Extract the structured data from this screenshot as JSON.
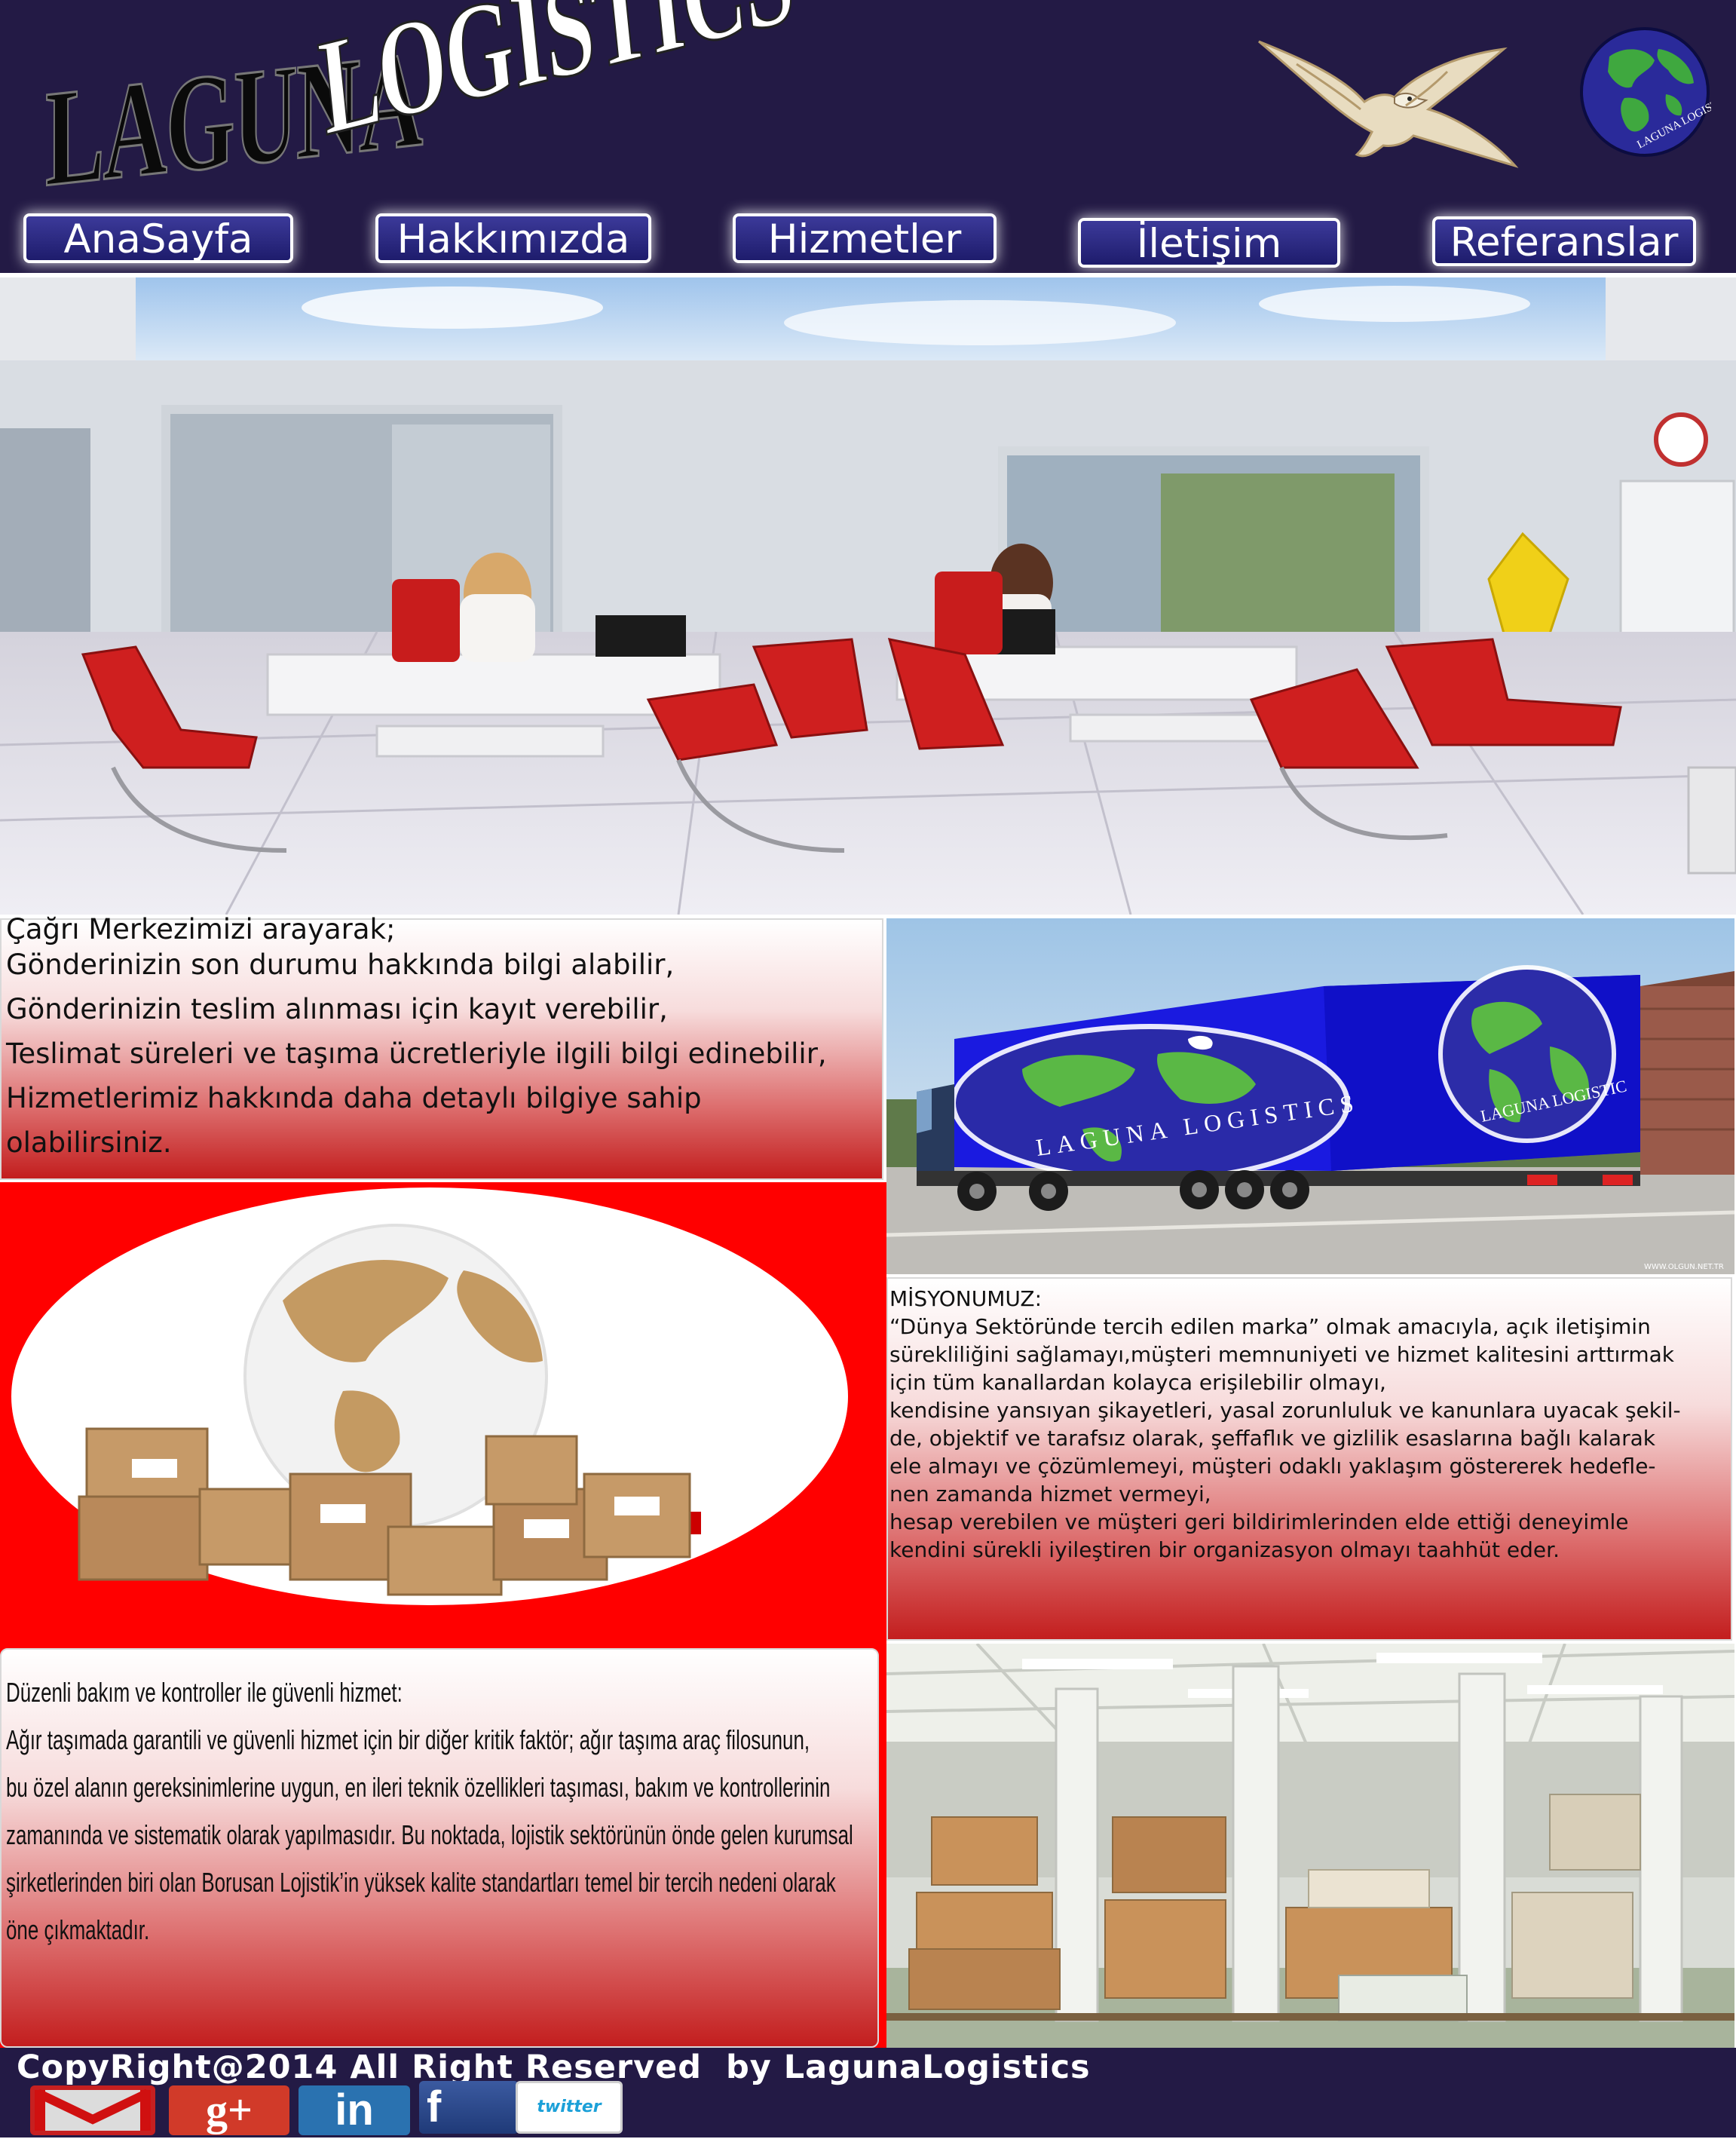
{
  "brand": {
    "word1": "LAGUNA",
    "word2": "LOGISTICS",
    "globe_text": "LAGUNA LOGISTICS"
  },
  "nav": {
    "items": [
      {
        "label": "AnaSayfa"
      },
      {
        "label": "Hakkımızda"
      },
      {
        "label": "Hizmetler"
      },
      {
        "label": "İletişim"
      },
      {
        "label": "Referanslar"
      }
    ]
  },
  "call_center": {
    "lines": [
      "Çağrı Merkezimizi arayarak;",
      "Gönderinizin son durumu hakkında bilgi alabilir,",
      "Gönderinizin teslim alınması için kayıt verebilir,",
      "Teslimat süreleri ve taşıma ücretleriyle ilgili bilgi edinebilir,",
      "Hizmetlerimiz hakkında daha detaylı bilgiye sahip",
      "olabilirsiniz."
    ]
  },
  "truck": {
    "side_text": "LAGUNA LOGISTICS",
    "globe_text": "LAGUNA LOGISTIC",
    "credit": "WWW.OLGUN.NET.TR"
  },
  "mission": {
    "title": " MİSYONUMUZ:",
    "lines": [
      "“Dünya Sektöründe tercih edilen marka” olmak amacıyla, açık iletişimin",
      "sürekliliğini sağlamayı,müşteri memnuniyeti ve hizmet kalitesini arttırmak",
      "için tüm kanallardan kolayca erişilebilir olmayı,",
      " kendisine yansıyan şikayetleri, yasal zorunluluk ve kanunlara uyacak şekil-",
      "de, objektif ve tarafsız olarak, şeffaflık ve gizlilik esaslarına bağlı kalarak",
      "ele almayı ve çözümlemeyi, müşteri odaklı yaklaşım göstererek hedefle-",
      "nen zamanda hizmet vermeyi,",
      "hesap verebilen ve müşteri geri bildirimlerinden elde ettiği deneyimle",
      "kendini sürekli iyileştiren bir organizasyon olmayı taahhüt eder."
    ]
  },
  "service": {
    "lines": [
      "Düzenli bakım ve kontroller ile güvenli hizmet:",
      "Ağır taşımada garantili ve güvenli hizmet için bir diğer kritik faktör; ağır taşıma araç filosunun,",
      " bu özel alanın gereksinimlerine uygun, en ileri teknik özellikleri taşıması, bakım ve kontrollerinin",
      "zamanında ve sistematik olarak yapılmasıdır. Bu noktada, lojistik sektörünün önde gelen kurumsal",
      " şirketlerinden biri olan Borusan Lojistik’in yüksek kalite standartları temel bir tercih nedeni olarak",
      "öne çıkmaktadır."
    ]
  },
  "footer": {
    "copyright": "CopyRight@2014 All Right Reserved  by LagunaLogistics",
    "social": [
      {
        "icon": "gmail-icon"
      },
      {
        "icon": "google-plus-icon",
        "label": "g+"
      },
      {
        "icon": "linkedin-icon",
        "label": "in"
      },
      {
        "icon": "facebook-icon",
        "label": "f"
      },
      {
        "icon": "twitter-icon",
        "label": "twitter"
      }
    ]
  },
  "colors": {
    "header_bg": "#231a45",
    "nav_button": "#2b2980",
    "accent_red": "#ff0000",
    "truck_blue": "#1a1ae0"
  }
}
